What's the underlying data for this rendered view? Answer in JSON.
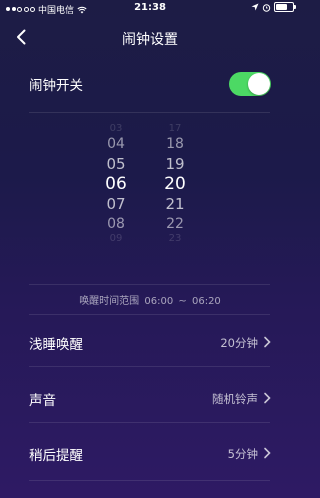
{
  "status_bar": {
    "carrier": "中国电信",
    "time": "21:38"
  },
  "nav": {
    "title": "闹钟设置",
    "back_icon": "chevron-left-icon"
  },
  "alarm_switch": {
    "label": "闹钟开关",
    "on": true,
    "on_color": "#4cd964"
  },
  "picker": {
    "hours": [
      "03",
      "04",
      "05",
      "06",
      "07",
      "08",
      "09"
    ],
    "minutes": [
      "17",
      "18",
      "19",
      "20",
      "21",
      "22",
      "23"
    ],
    "selected_hour": "06",
    "selected_minute": "20"
  },
  "wake_range": {
    "label": "唤醒时间范围",
    "start": "06:00",
    "separator": "~",
    "end": "06:20"
  },
  "settings": [
    {
      "label": "浅睡唤醒",
      "value": "20分钟"
    },
    {
      "label": "声音",
      "value": "随机铃声"
    },
    {
      "label": "稍后提醒",
      "value": "5分钟"
    }
  ]
}
